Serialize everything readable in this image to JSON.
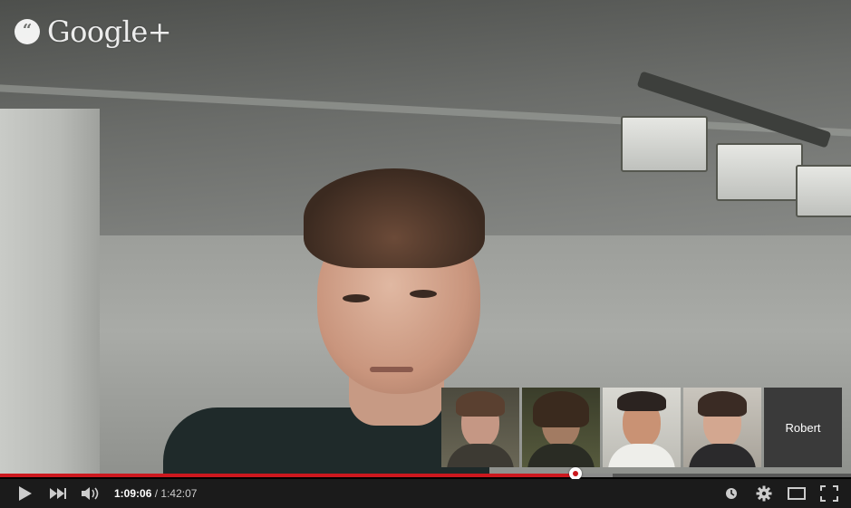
{
  "window": {
    "title": ""
  },
  "branding": {
    "logo_text": "Google+",
    "icon": "hangouts-quote-icon"
  },
  "main_video": {
    "participant": ""
  },
  "filmstrip": {
    "tiles": [
      {
        "type": "video",
        "label": ""
      },
      {
        "type": "video",
        "label": ""
      },
      {
        "type": "video",
        "label": ""
      },
      {
        "type": "video",
        "label": ""
      },
      {
        "type": "name",
        "label": "Robert"
      }
    ]
  },
  "player": {
    "current_time": "1:09:06",
    "separator": " / ",
    "duration": "1:42:07",
    "played_fraction": 0.6766,
    "loaded_fraction": 0.72,
    "icons": {
      "play": "play-icon",
      "next": "next-icon",
      "volume": "volume-icon",
      "watch_later": "watch-later-icon",
      "settings": "gear-icon",
      "theater": "theater-mode-icon",
      "fullscreen": "fullscreen-icon"
    }
  },
  "colors": {
    "accent": "#cc181e",
    "controls_bg": "#1b1b1b"
  }
}
